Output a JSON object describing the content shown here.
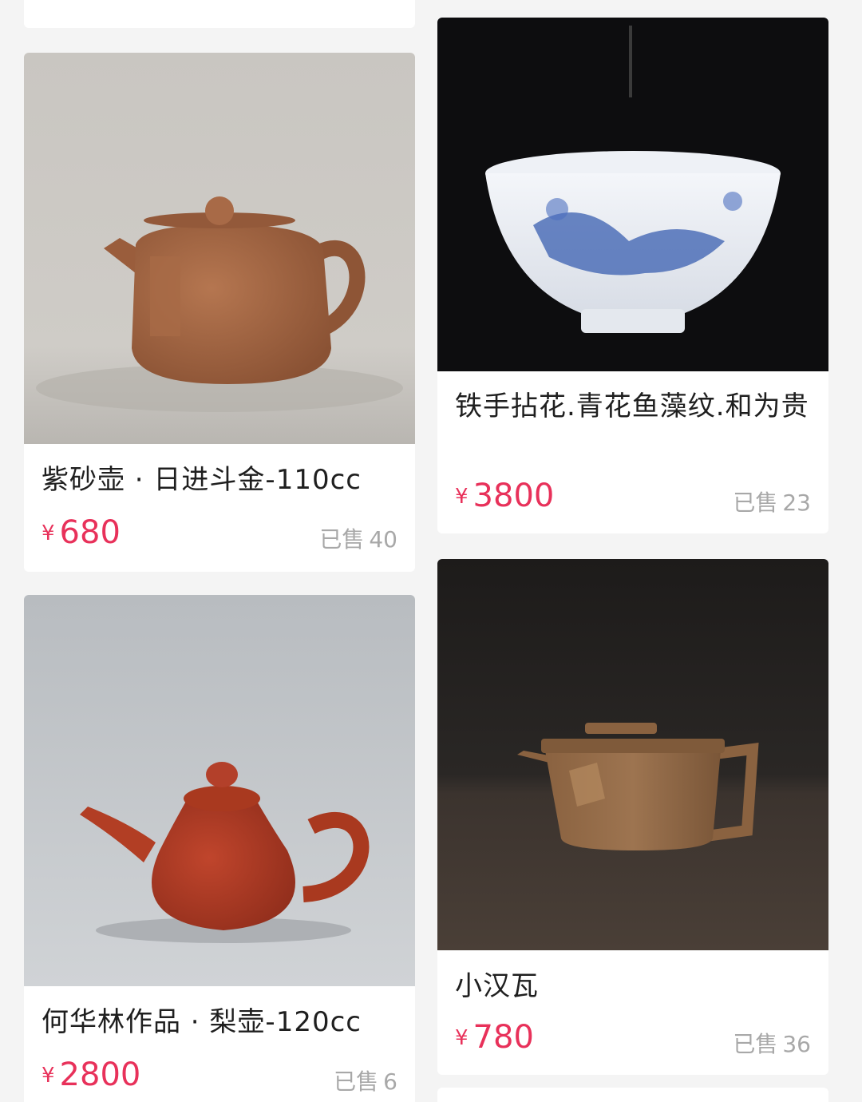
{
  "products": [
    {
      "id": "left-1",
      "title": "紫砂壶 · 日进斗金-110cc",
      "currency": "¥",
      "price": "680",
      "sold_label": "已售",
      "sold_count": "40"
    },
    {
      "id": "right-1",
      "title": "铁手拈花.青花鱼藻纹.和为贵",
      "currency": "¥",
      "price": "3800",
      "sold_label": "已售",
      "sold_count": "23"
    },
    {
      "id": "left-2",
      "title": "何华林作品 · 梨壶-120cc",
      "currency": "¥",
      "price": "2800",
      "sold_label": "已售",
      "sold_count": "6"
    },
    {
      "id": "right-2",
      "title": "小汉瓦",
      "currency": "¥",
      "price": "780",
      "sold_label": "已售",
      "sold_count": "36"
    }
  ],
  "colors": {
    "page_bg": "#f4f4f4",
    "card_bg": "#ffffff",
    "price": "#e8315a",
    "sold": "#a8a8a8",
    "title": "#1f1f1f"
  }
}
